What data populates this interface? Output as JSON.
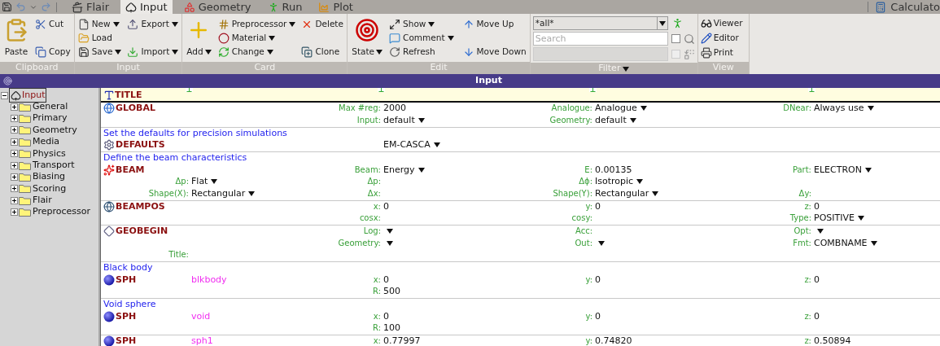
{
  "top_bar": {
    "tabs": [
      {
        "label": "Flair",
        "selected": false
      },
      {
        "label": "Input",
        "selected": true
      },
      {
        "label": "Geometry",
        "selected": false
      },
      {
        "label": "Run",
        "selected": false
      },
      {
        "label": "Plot",
        "selected": false
      }
    ],
    "calculator": "Calculato"
  },
  "ribbon": {
    "groups": [
      {
        "label": "Clipboard",
        "columns": [
          [
            {
              "label": "Paste",
              "kind": "large",
              "dropdown": false
            }
          ],
          [
            {
              "label": "Cut",
              "kind": "small",
              "dropdown": false
            },
            {
              "label": "Copy",
              "kind": "small",
              "dropdown": false
            }
          ]
        ]
      },
      {
        "label": "Input",
        "columns": [
          [
            {
              "label": "New",
              "kind": "small",
              "dropdown": true
            },
            {
              "label": "Load",
              "kind": "small",
              "dropdown": false
            },
            {
              "label": "Save",
              "kind": "small",
              "dropdown": true
            }
          ],
          [
            {
              "label": "Export",
              "kind": "small",
              "dropdown": true
            },
            {
              "label": "Import",
              "kind": "small",
              "dropdown": true
            }
          ]
        ]
      },
      {
        "label": "Card",
        "columns": [
          [
            {
              "label": "Add",
              "kind": "large",
              "dropdown": true
            }
          ],
          [
            {
              "label": "Preprocessor",
              "kind": "small",
              "dropdown": true
            },
            {
              "label": "Material",
              "kind": "small",
              "dropdown": true
            },
            {
              "label": "Change",
              "kind": "small",
              "dropdown": true
            }
          ],
          [
            {
              "label": "Delete",
              "kind": "small",
              "dropdown": false
            },
            {
              "label": "Clone",
              "kind": "small",
              "dropdown": false
            }
          ]
        ]
      },
      {
        "label": "Edit",
        "columns": [
          [
            {
              "label": "State",
              "kind": "large",
              "dropdown": true
            }
          ],
          [
            {
              "label": "Show",
              "kind": "small",
              "dropdown": true
            },
            {
              "label": "Comment",
              "kind": "small",
              "dropdown": true
            },
            {
              "label": "Refresh",
              "kind": "small",
              "dropdown": false
            }
          ],
          [
            {
              "label": "Move Up",
              "kind": "small",
              "dropdown": false
            },
            {
              "label": "Move Down",
              "kind": "small",
              "dropdown": false
            }
          ]
        ]
      }
    ],
    "filter": {
      "label": "Filter",
      "combo": "*all*",
      "search": {
        "placeholder": "Search",
        "checked": false
      },
      "second": {
        "disabled": true,
        "checked": false
      }
    },
    "view": {
      "label": "View",
      "buttons": [
        "Viewer",
        "Editor",
        "Print"
      ]
    }
  },
  "panel_title": "Input",
  "tree": {
    "label": "Input",
    "expanded": true,
    "selected": true,
    "children": [
      {
        "label": "General",
        "expanded": false
      },
      {
        "label": "Primary",
        "expanded": false
      },
      {
        "label": "Geometry",
        "expanded": false
      },
      {
        "label": "Media",
        "expanded": false
      },
      {
        "label": "Physics",
        "expanded": false
      },
      {
        "label": "Transport",
        "expanded": false
      },
      {
        "label": "Biasing",
        "expanded": false
      },
      {
        "label": "Scoring",
        "expanded": false
      },
      {
        "label": "Flair",
        "expanded": false
      },
      {
        "label": "Preprocessor",
        "expanded": false
      }
    ]
  },
  "title_card": "TITLE",
  "cards": [
    {
      "name": "GLOBAL",
      "fields": [
        {
          "col_1": {
            "label": "Max #reg:",
            "value": "2000",
            "dropdown": false
          },
          "col_2": {
            "label": "Analogue:",
            "value": "Analogue",
            "dropdown": true
          },
          "col_3": {
            "label": "DNear:",
            "value": "Always use",
            "dropdown": true
          }
        },
        {
          "col_1": {
            "label": "Input:",
            "value": "default",
            "dropdown": true
          },
          "col_2": {
            "label": "Geometry:",
            "value": "default",
            "dropdown": true
          }
        }
      ]
    },
    {
      "comment": "Set the defaults for precision simulations",
      "name": "DEFAULTS",
      "fields": [
        {
          "col_1": {
            "value": "EM-CASCA",
            "dropdown": true
          }
        }
      ]
    },
    {
      "comment": "Define the beam characteristics",
      "name": "BEAM",
      "fields": [
        {
          "col_1": {
            "label": "Beam:",
            "value": "Energy",
            "dropdown": true
          },
          "col_2": {
            "label": "E:",
            "value": "0.00135",
            "dropdown": false
          },
          "col_3": {
            "label": "Part:",
            "value": "ELECTRON",
            "dropdown": true
          }
        },
        {
          "col_0": {
            "label": "Δp:",
            "value": "Flat",
            "dropdown": true
          },
          "col_1": {
            "label": "Δp:",
            "dropdown": false
          },
          "col_2": {
            "label": "Δϕ:",
            "value": "Isotropic",
            "dropdown": true
          }
        },
        {
          "col_0": {
            "label": "Shape(X):",
            "value": "Rectangular",
            "dropdown": true
          },
          "col_1": {
            "label": "Δx:",
            "dropdown": false
          },
          "col_2": {
            "label": "Shape(Y):",
            "value": "Rectangular",
            "dropdown": true
          },
          "col_3": {
            "label": "Δy:",
            "dropdown": false
          }
        }
      ]
    },
    {
      "name": "BEAMPOS",
      "fields": [
        {
          "col_1": {
            "label": "x:",
            "value": "0",
            "dropdown": false
          },
          "col_2": {
            "label": "y:",
            "value": "0",
            "dropdown": false
          },
          "col_3": {
            "label": "z:",
            "value": "0",
            "dropdown": false
          }
        },
        {
          "col_1": {
            "label": "cosx:",
            "dropdown": false
          },
          "col_2": {
            "label": "cosy:",
            "dropdown": false
          },
          "col_3": {
            "label": "Type:",
            "value": "POSITIVE",
            "dropdown": true
          }
        }
      ]
    },
    {
      "name": "GEOBEGIN",
      "fields": [
        {
          "col_1": {
            "label": "Log:",
            "dropdown": true
          },
          "col_2": {
            "label": "Acc:",
            "dropdown": false
          },
          "col_3": {
            "label": "Opt:",
            "dropdown": true
          }
        },
        {
          "col_1": {
            "label": "Geometry:",
            "dropdown": true
          },
          "col_2": {
            "label": "Out:",
            "dropdown": true
          },
          "col_3": {
            "label": "Fmt:",
            "value": "COMBNAME",
            "dropdown": true
          }
        },
        {
          "col_0": {
            "label": "Title:",
            "dropdown": false
          }
        }
      ]
    },
    {
      "comment": "Black body",
      "name": "SPH",
      "id": "blkbody",
      "fields": [
        {
          "col_1": {
            "label": "x:",
            "value": "0",
            "dropdown": false
          },
          "col_2": {
            "label": "y:",
            "value": "0",
            "dropdown": false
          },
          "col_3": {
            "label": "z:",
            "value": "0",
            "dropdown": false
          }
        },
        {
          "col_1": {
            "label": "R:",
            "value": "500",
            "dropdown": false
          }
        }
      ]
    },
    {
      "comment": "Void sphere",
      "name": "SPH",
      "id": "void",
      "fields": [
        {
          "col_1": {
            "label": "x:",
            "value": "0",
            "dropdown": false
          },
          "col_2": {
            "label": "y:",
            "value": "0",
            "dropdown": false
          },
          "col_3": {
            "label": "z:",
            "value": "0",
            "dropdown": false
          }
        },
        {
          "col_1": {
            "label": "R:",
            "value": "100",
            "dropdown": false
          }
        }
      ]
    },
    {
      "name": "SPH",
      "id": "sph1",
      "fields": [
        {
          "col_1": {
            "label": "x:",
            "value": "0.77997",
            "dropdown": false
          },
          "col_2": {
            "label": "y:",
            "value": "0.74820",
            "dropdown": false
          },
          "col_3": {
            "label": "z:",
            "value": "0.50894",
            "dropdown": false
          }
        }
      ]
    }
  ]
}
